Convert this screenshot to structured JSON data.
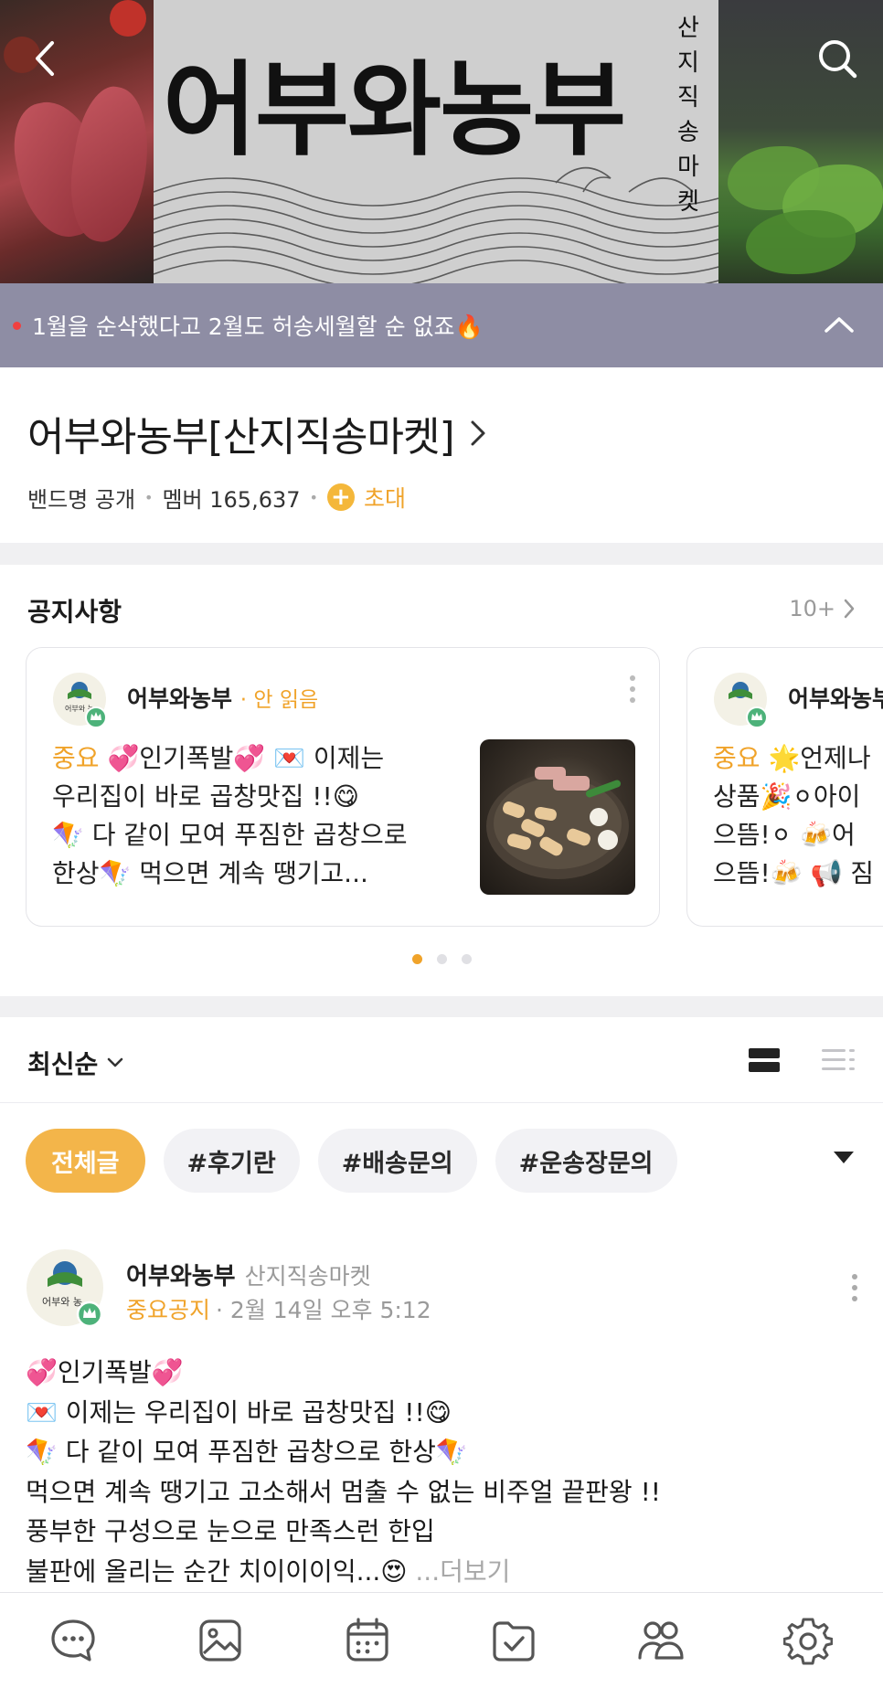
{
  "cover": {
    "title": "어부와농부",
    "vertical_text": "산지직송마켓"
  },
  "announcement": {
    "text": "1월을 순삭했다고 2월도 허송세월할 순 없죠🔥"
  },
  "band": {
    "name": "어부와농부[산지직송마켓]",
    "visibility": "밴드명 공개",
    "members_label": "멤버 165,637",
    "invite_label": "초대"
  },
  "notices": {
    "header": "공지사항",
    "more_label": "10+",
    "cards": [
      {
        "author": "어부와농부",
        "status": "안 읽음",
        "tag": "중요",
        "lines": [
          "💞인기폭발💞 💌 이제는",
          "우리집이 바로 곱창맛집 !!😋",
          "🪁 다 같이 모여 푸짐한 곱창으로",
          "한상🪁 먹으면 계속 땡기고..."
        ]
      },
      {
        "author": "어부와농부",
        "tag": "중요",
        "lines": [
          "🌟언제나",
          "상품🎉⚪아이",
          "으뜸!⚪ 🍻어",
          "으뜸!🍻 📢 짐"
        ]
      }
    ],
    "page_count": 3,
    "active_page": 0
  },
  "sort": {
    "label": "최신순"
  },
  "chips": [
    {
      "label": "전체글",
      "active": true
    },
    {
      "label": "#후기란",
      "active": false
    },
    {
      "label": "#배송문의",
      "active": false
    },
    {
      "label": "#운송장문의",
      "active": false
    }
  ],
  "post": {
    "author": "어부와농부",
    "band_name": "산지직송마켓",
    "tag": "중요공지",
    "time": "· 2월 14일 오후 5:12",
    "lines": [
      "💞인기폭발💞",
      "💌 이제는 우리집이 바로 곱창맛집 !!😋",
      "🪁 다 같이 모여 푸짐한 곱창으로 한상🪁",
      "먹으면 계속 땡기고 고소해서 멈출 수 없는 비주얼 끝판왕 !!",
      "풍부한 구성으로 눈으로 만족스런 한입",
      "불판에 올리는 순간 치이이이익...😍"
    ],
    "more_label": "...더보기"
  },
  "avatar_text": "어부와 농",
  "colors": {
    "accent": "#f0a32a",
    "chip_active": "#f3b54a",
    "announce_bg": "#8e8da4",
    "divider": "#f0f0f2"
  },
  "bottom_nav": [
    {
      "icon": "chat-icon"
    },
    {
      "icon": "photo-icon"
    },
    {
      "icon": "calendar-icon"
    },
    {
      "icon": "folder-check-icon"
    },
    {
      "icon": "members-icon"
    },
    {
      "icon": "settings-icon"
    }
  ]
}
